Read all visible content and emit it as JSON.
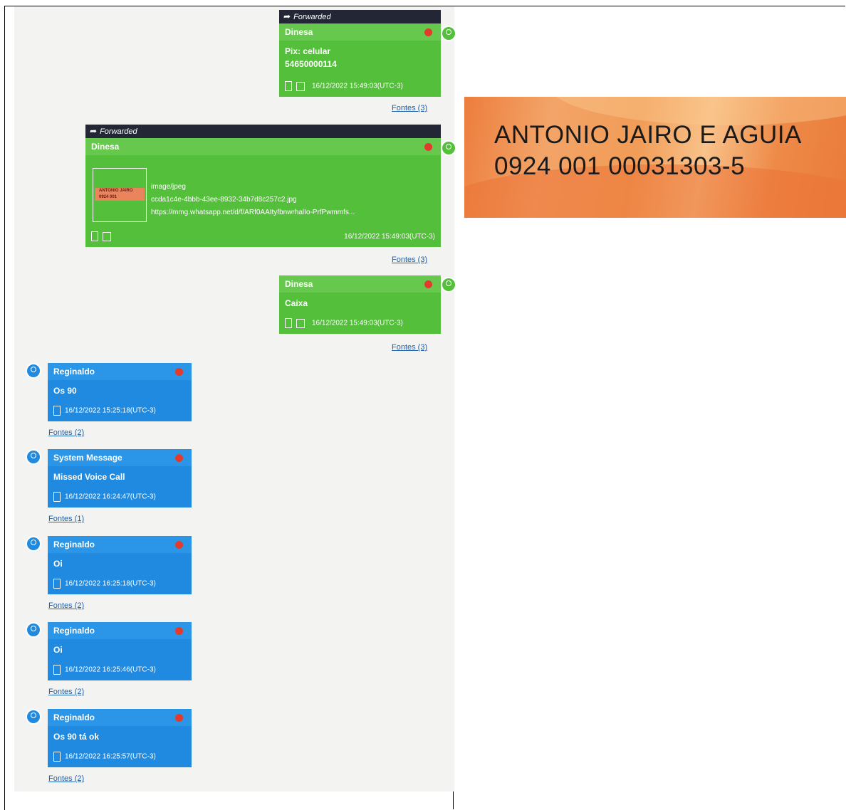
{
  "messages": {
    "m1": {
      "sender": "Dinesa",
      "forwarded": "Forwarded",
      "line1": "Pix: celular",
      "line2": "54650000114",
      "time": "16/12/2022 15:49:03(UTC-3)",
      "sources": "Fontes (3)"
    },
    "m2": {
      "sender": "Dinesa",
      "forwarded": "Forwarded",
      "mime": "image/jpeg",
      "file": "ccda1c4e-4bbb-43ee-8932-34b7d8c257c2.jpg",
      "url": "https://mmg.whatsapp.net/d/f/ARf0AAItyfbnwrhalIo-PrfPwmmfs...",
      "time": "16/12/2022 15:49:03(UTC-3)",
      "sources": "Fontes (3)"
    },
    "m3": {
      "sender": "Dinesa",
      "text": "Caixa",
      "time": "16/12/2022 15:49:03(UTC-3)",
      "sources": "Fontes (3)"
    },
    "m4": {
      "sender": "Reginaldo",
      "text": "Os 90",
      "time": "16/12/2022 15:25:18(UTC-3)",
      "sources": "Fontes (2)"
    },
    "m5": {
      "sender": "System Message",
      "text": "Missed Voice Call",
      "time": "16/12/2022 16:24:47(UTC-3)",
      "sources": "Fontes (1)"
    },
    "m6": {
      "sender": "Reginaldo",
      "text": "Oi",
      "time": "16/12/2022 16:25:18(UTC-3)",
      "sources": "Fontes (2)"
    },
    "m7": {
      "sender": "Reginaldo",
      "text": "Oi",
      "time": "16/12/2022 16:25:46(UTC-3)",
      "sources": "Fontes (2)"
    },
    "m8": {
      "sender": "Reginaldo",
      "text": "Os 90 tá ok",
      "time": "16/12/2022 16:25:57(UTC-3)",
      "sources": "Fontes (2)"
    }
  },
  "attachment_image": {
    "line1": "ANTONIO JAIRO E AGUIA",
    "line2": "0924 001 00031303-5"
  },
  "colors": {
    "outgoing": "#54bf3a",
    "incoming": "#1f8ae0",
    "forward_bar": "#232634",
    "status_dot": "#e33a2c"
  }
}
